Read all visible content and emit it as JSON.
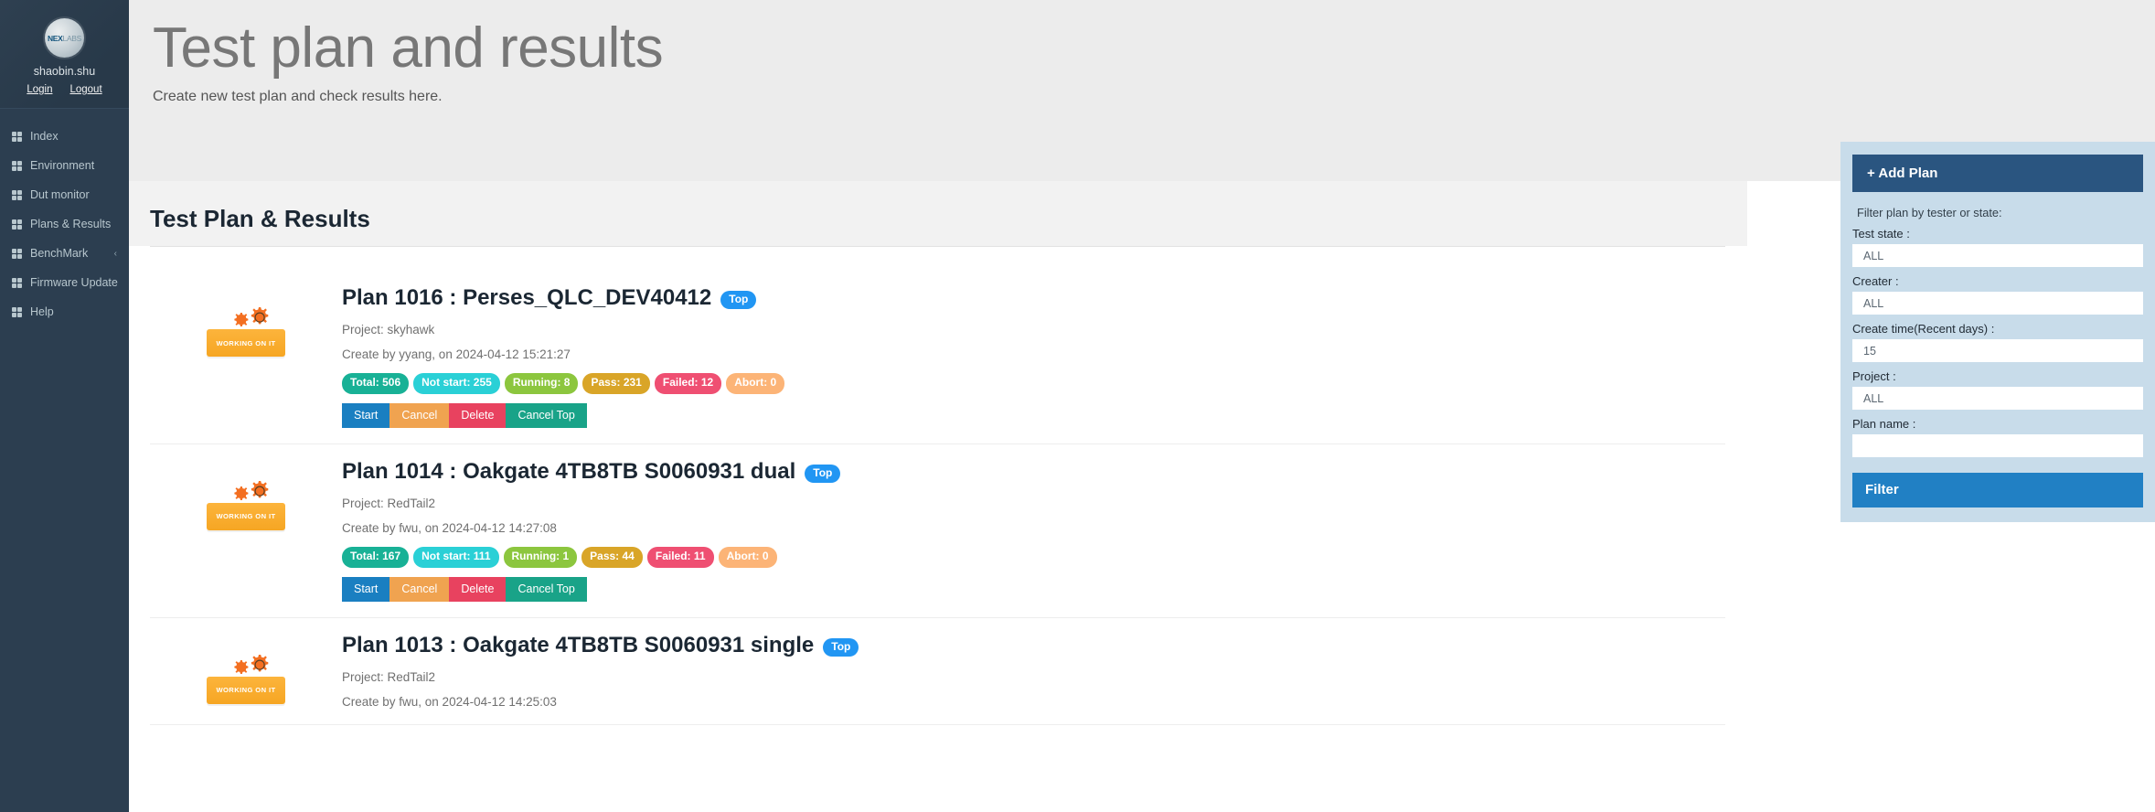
{
  "sidebar": {
    "avatar_nex": "NEX",
    "avatar_labs": "LABS",
    "username": "shaobin.shu",
    "login_label": "Login",
    "logout_label": "Logout",
    "items": [
      {
        "label": "Index",
        "icon": "grid-icon",
        "chevron": ""
      },
      {
        "label": "Environment",
        "icon": "grid-icon",
        "chevron": ""
      },
      {
        "label": "Dut monitor",
        "icon": "grid-icon",
        "chevron": ""
      },
      {
        "label": "Plans & Results",
        "icon": "grid-icon",
        "chevron": ""
      },
      {
        "label": "BenchMark",
        "icon": "grid-icon",
        "chevron": "‹"
      },
      {
        "label": "Firmware Update",
        "icon": "grid-icon",
        "chevron": ""
      },
      {
        "label": "Help",
        "icon": "grid-icon",
        "chevron": ""
      }
    ]
  },
  "header": {
    "title": "Test plan and results",
    "subtitle": "Create new test plan and check results here."
  },
  "main": {
    "section_title": "Test Plan & Results",
    "working_badge_text": "WORKING ON IT",
    "top_badge_label": "Top",
    "plans": [
      {
        "name": "Plan 1016 : Perses_QLC_DEV40412",
        "is_top": true,
        "project": "Project: skyhawk",
        "create": "Create by yyang, on 2024-04-12 15:21:27",
        "stats": [
          {
            "label": "Total: 506",
            "color": "#18b196"
          },
          {
            "label": "Not start: 255",
            "color": "#2ad0d6"
          },
          {
            "label": "Running: 8",
            "color": "#8cc63e"
          },
          {
            "label": "Pass: 231",
            "color": "#d9a528"
          },
          {
            "label": "Failed: 12",
            "color": "#ef4f72"
          },
          {
            "label": "Abort: 0",
            "color": "#fcb477"
          }
        ],
        "buttons": [
          {
            "label": "Start",
            "color": "#1a7fc1"
          },
          {
            "label": "Cancel",
            "color": "#f0a350"
          },
          {
            "label": "Delete",
            "color": "#e8425f"
          },
          {
            "label": "Cancel Top",
            "color": "#19a388"
          }
        ]
      },
      {
        "name": "Plan 1014 : Oakgate 4TB8TB S0060931 dual",
        "is_top": true,
        "project": "Project: RedTail2",
        "create": "Create by fwu, on 2024-04-12 14:27:08",
        "stats": [
          {
            "label": "Total: 167",
            "color": "#18b196"
          },
          {
            "label": "Not start: 111",
            "color": "#2ad0d6"
          },
          {
            "label": "Running: 1",
            "color": "#8cc63e"
          },
          {
            "label": "Pass: 44",
            "color": "#d9a528"
          },
          {
            "label": "Failed: 11",
            "color": "#ef4f72"
          },
          {
            "label": "Abort: 0",
            "color": "#fcb477"
          }
        ],
        "buttons": [
          {
            "label": "Start",
            "color": "#1a7fc1"
          },
          {
            "label": "Cancel",
            "color": "#f0a350"
          },
          {
            "label": "Delete",
            "color": "#e8425f"
          },
          {
            "label": "Cancel Top",
            "color": "#19a388"
          }
        ]
      },
      {
        "name": "Plan 1013 : Oakgate 4TB8TB S0060931 single",
        "is_top": true,
        "project": "Project: RedTail2",
        "create": "Create by fwu, on 2024-04-12 14:25:03",
        "stats": [],
        "buttons": []
      }
    ]
  },
  "filter": {
    "add_plan_label": "+ Add Plan",
    "hint": "Filter plan by tester or state:",
    "fields": [
      {
        "label": "Test state :",
        "value": "ALL"
      },
      {
        "label": "Creater :",
        "value": "ALL"
      },
      {
        "label": "Create time(Recent days) :",
        "value": "15"
      },
      {
        "label": "Project :",
        "value": "ALL"
      },
      {
        "label": "Plan name :",
        "value": ""
      }
    ],
    "filter_label": "Filter"
  },
  "colors": {
    "sidebar_bg": "#2c3e50",
    "header_bg": "#ececec",
    "panel_bg": "#c8dcea",
    "add_plan": "#2a5580",
    "filter_btn": "#2180c4",
    "top_badge": "#2196f3"
  }
}
